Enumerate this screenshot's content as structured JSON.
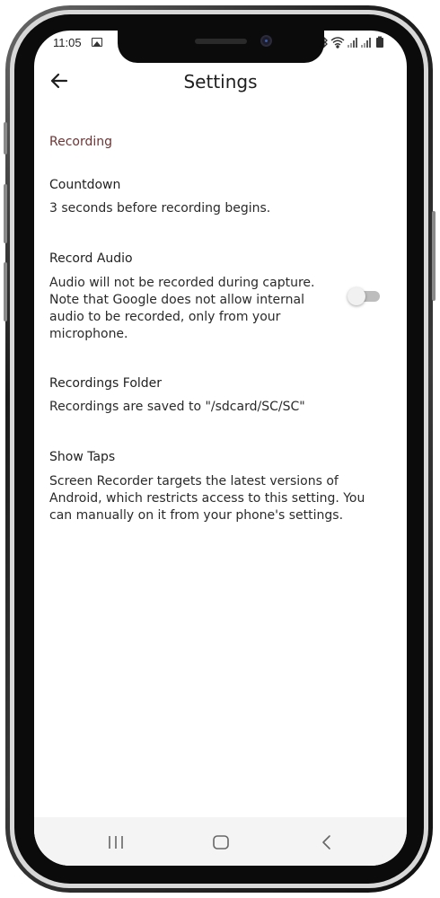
{
  "status_bar": {
    "time": "11:05",
    "icons": [
      "image-icon",
      "bluetooth-icon",
      "wifi-icon",
      "signal-icon",
      "signal-icon",
      "battery-icon"
    ]
  },
  "app_bar": {
    "title": "Settings",
    "back_icon": "arrow-back-icon"
  },
  "settings": {
    "section_header": "Recording",
    "countdown": {
      "title": "Countdown",
      "summary": "3 seconds before recording begins."
    },
    "record_audio": {
      "title": "Record Audio",
      "summary_lines": [
        "Audio will not be recorded during capture.",
        "Note that Google does not allow internal",
        "audio to be recorded, only from your",
        "microphone."
      ],
      "toggle_on": false
    },
    "recordings_folder": {
      "title": "Recordings Folder",
      "summary": "Recordings are saved to \"/sdcard/SC/SC\""
    },
    "show_taps": {
      "title": "Show Taps",
      "summary_lines": [
        "Screen Recorder targets the latest versions of",
        "Android, which restricts access to this setting. You",
        "can manually on it from your phone's settings."
      ]
    }
  },
  "nav_bar": {
    "icons": [
      "recent-apps-icon",
      "home-icon",
      "back-icon"
    ]
  },
  "colors": {
    "section_header": "#6b3535",
    "text": "#1f1f1f",
    "toggle_track_off": "#bdbdbd",
    "nav_bar_bg": "#f4f4f4"
  }
}
